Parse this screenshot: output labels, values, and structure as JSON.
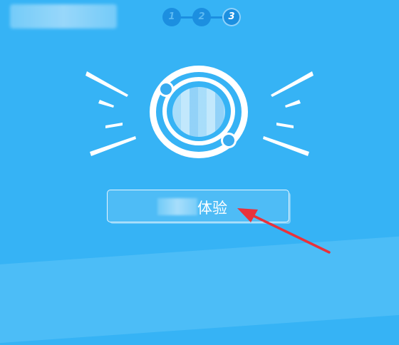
{
  "steps": [
    {
      "label": "1",
      "active": false
    },
    {
      "label": "2",
      "active": false
    },
    {
      "label": "3",
      "active": true
    }
  ],
  "colors": {
    "background": "#36b3f5",
    "step": "#1c8fe0",
    "annotation_arrow": "#e8323c"
  },
  "logo": {
    "icon": "app-logo-icon"
  },
  "cta": {
    "label": "体验"
  }
}
